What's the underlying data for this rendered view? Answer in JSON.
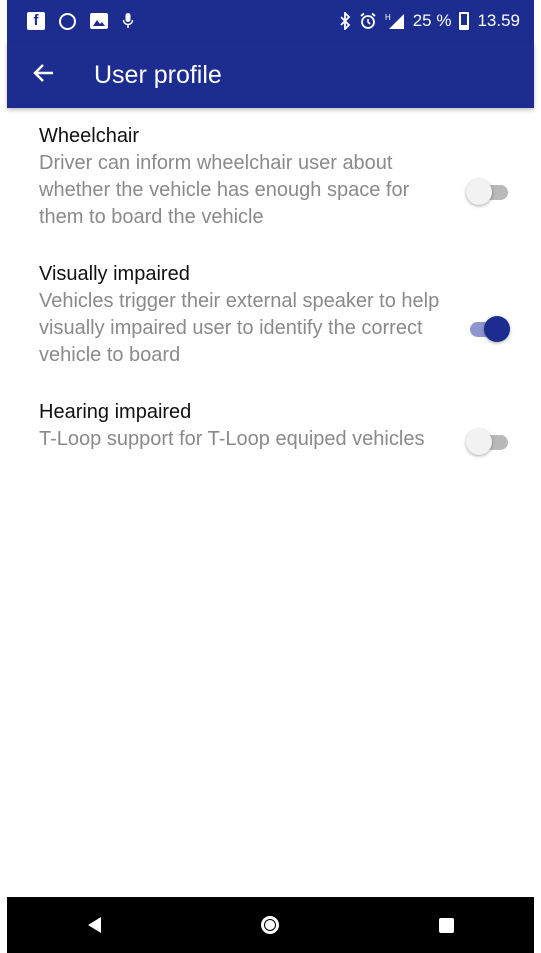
{
  "status_bar": {
    "battery": "25 %",
    "time": "13.59",
    "icons": [
      "facebook-icon",
      "whatsapp-icon",
      "gallery-icon",
      "microphone-icon",
      "bluetooth-icon",
      "alarm-icon",
      "signal-icon",
      "battery-icon"
    ]
  },
  "app_bar": {
    "title": "User profile",
    "color": "#1c2d8f"
  },
  "settings": [
    {
      "title": "Wheelchair",
      "description": "Driver can inform wheelchair user about whether the vehicle has enough space for them to board the vehicle",
      "enabled": false
    },
    {
      "title": "Visually impaired",
      "description": "Vehicles trigger their external speaker to help visually impaired user to identify the correct vehicle to board",
      "enabled": true
    },
    {
      "title": "Hearing impaired",
      "description": "T-Loop support for T-Loop equiped vehicles",
      "enabled": false
    }
  ],
  "nav_bar": {
    "buttons": [
      "back-icon",
      "home-icon",
      "recents-icon"
    ]
  }
}
